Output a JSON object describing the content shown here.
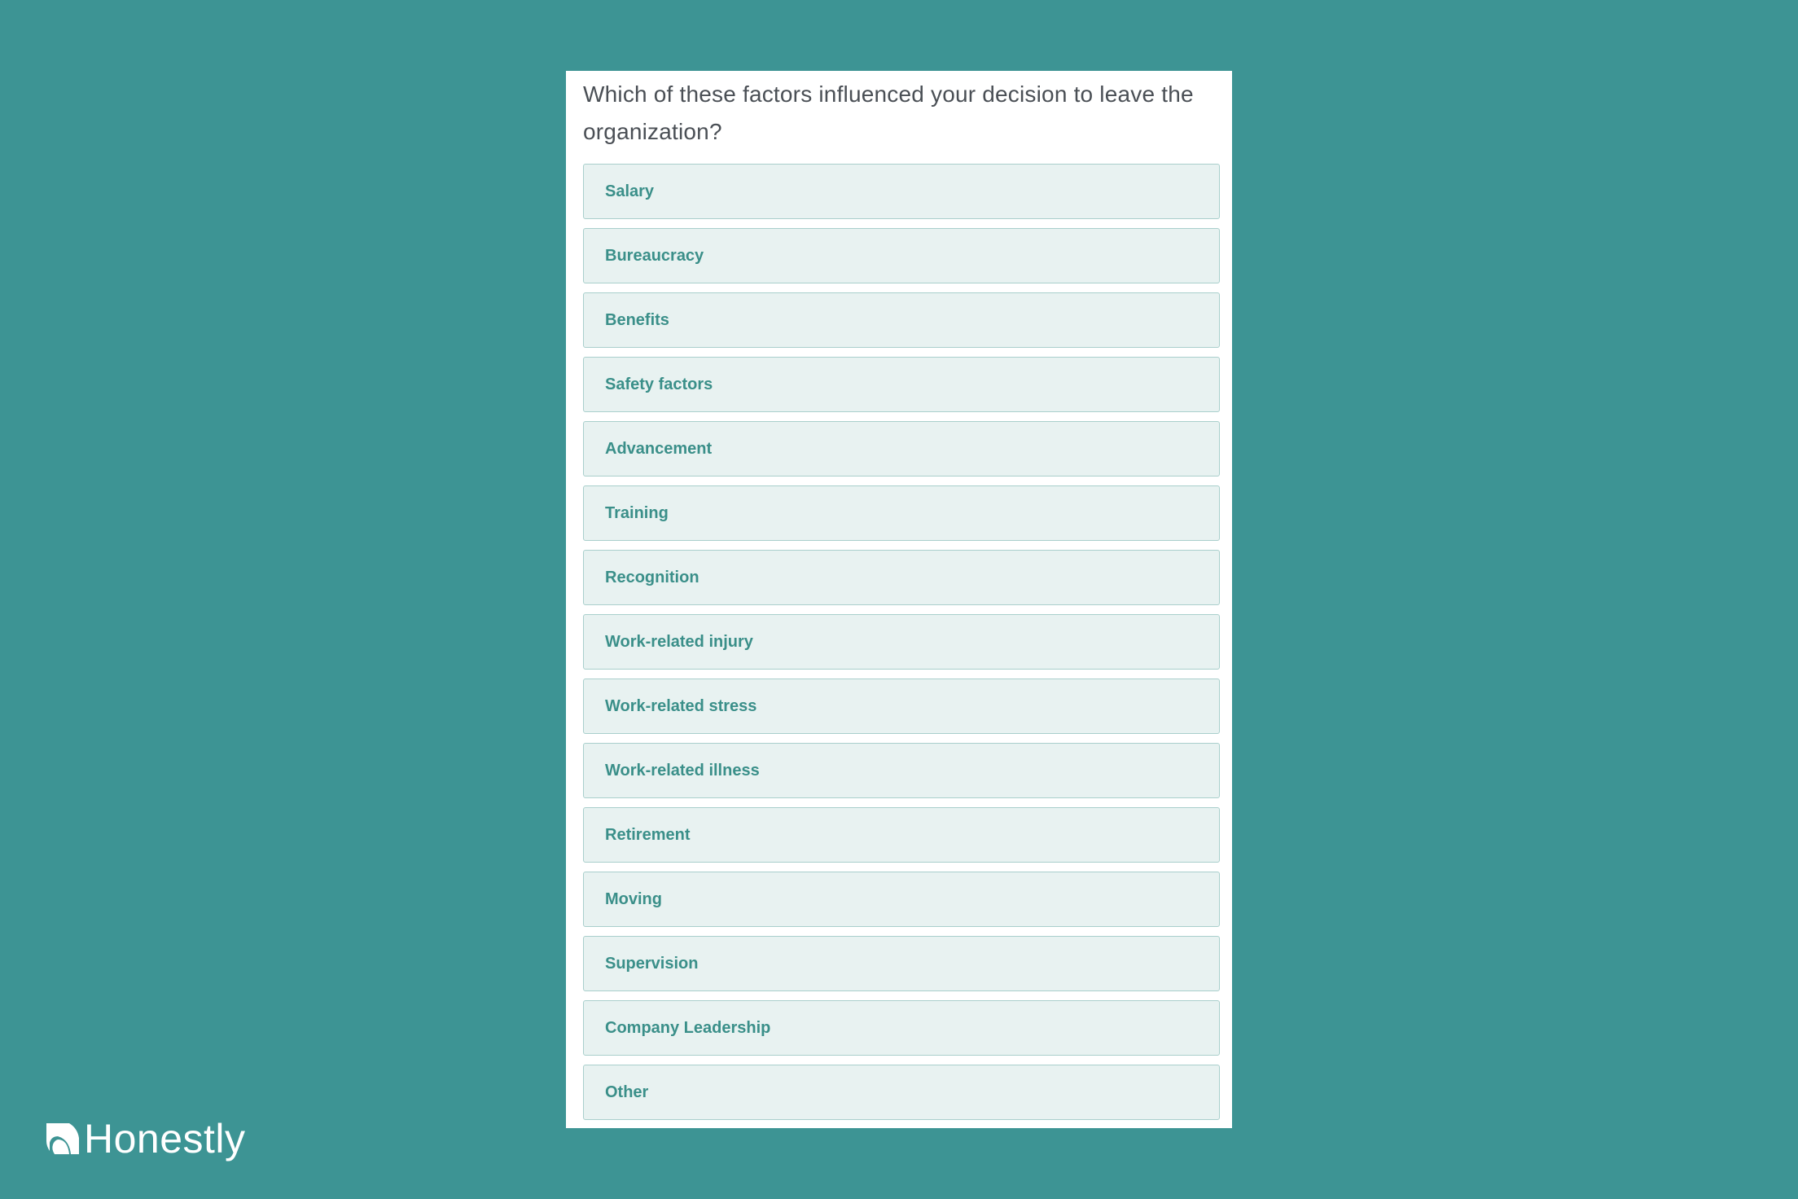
{
  "survey": {
    "question": "Which of these factors influenced your decision to leave the organization?",
    "options": [
      {
        "label": "Salary"
      },
      {
        "label": "Bureaucracy"
      },
      {
        "label": "Benefits"
      },
      {
        "label": "Safety factors"
      },
      {
        "label": "Advancement"
      },
      {
        "label": "Training"
      },
      {
        "label": "Recognition"
      },
      {
        "label": "Work-related injury"
      },
      {
        "label": "Work-related stress"
      },
      {
        "label": "Work-related illness"
      },
      {
        "label": "Retirement"
      },
      {
        "label": "Moving"
      },
      {
        "label": "Supervision"
      },
      {
        "label": "Company Leadership"
      },
      {
        "label": "Other"
      }
    ]
  },
  "brand": {
    "name": "Honestly",
    "logo_icon": "honestly-logo-mark",
    "colors": {
      "background": "#3d9494",
      "option_text": "#3a8f89",
      "option_bg": "#e8f2f1"
    }
  }
}
